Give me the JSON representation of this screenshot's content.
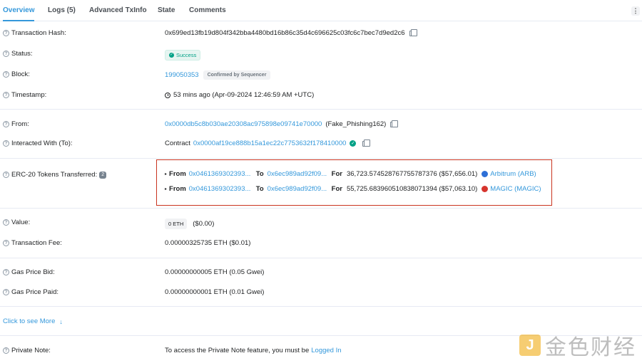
{
  "tabs": [
    {
      "label": "Overview"
    },
    {
      "label": "Logs (5)"
    },
    {
      "label": "Advanced TxInfo"
    },
    {
      "label": "State"
    },
    {
      "label": "Comments"
    }
  ],
  "more_menu": "⋮",
  "labels": {
    "hash": "Transaction Hash:",
    "status": "Status:",
    "block": "Block:",
    "timestamp": "Timestamp:",
    "from": "From:",
    "to": "Interacted With (To):",
    "erc20": "ERC-20 Tokens Transferred:",
    "value": "Value:",
    "fee": "Transaction Fee:",
    "gas_bid": "Gas Price Bid:",
    "gas_paid": "Gas Price Paid:",
    "private_note": "Private Note:"
  },
  "values": {
    "hash": "0x699ed13fb19d804f342bba4480bd16b86c35d4c696625c03fc6c7bec7d9ed2c6",
    "status": "Success",
    "block": "199050353",
    "block_badge": "Confirmed by Sequencer",
    "timestamp": "53 mins ago (Apr-09-2024 12:46:59 AM +UTC)",
    "from_addr": "0x0000db5c8b030ae20308ac975898e09741e70000",
    "from_name": "(Fake_Phishing162)",
    "to_prefix": "Contract",
    "to_addr": "0x0000af19ce888b15a1ec22c7753632f178410000",
    "erc20_count": "2",
    "value_eth": "0 ETH",
    "value_usd": "($0.00)",
    "fee": "0.00000325735 ETH ($0.01)",
    "gas_bid": "0.00000000005 ETH (0.05 Gwei)",
    "gas_paid": "0.00000000001 ETH (0.01 Gwei)",
    "more_link": "Click to see More",
    "more_arrow": "↓",
    "private_note_text": "To access the Private Note feature, you must be",
    "private_note_link": "Logged In"
  },
  "transfers": [
    {
      "from_label": "From",
      "from": "0x0461369302393...",
      "to_label": "To",
      "to": "0x6ec989ad92f09...",
      "for_label": "For",
      "amount": "36,723.574528767755787376 ($57,656.01)",
      "token": "Arbitrum (ARB)",
      "token_color": "#2d6fd6"
    },
    {
      "from_label": "From",
      "from": "0x0461369302393...",
      "to_label": "To",
      "to": "0x6ec989ad92f09...",
      "for_label": "For",
      "amount": "55,725.683960510838071394 ($57,063.10)",
      "token": "MAGIC (MAGIC)",
      "token_color": "#d6342d"
    }
  ],
  "watermark": {
    "logo": "J",
    "text": "金色财经"
  }
}
